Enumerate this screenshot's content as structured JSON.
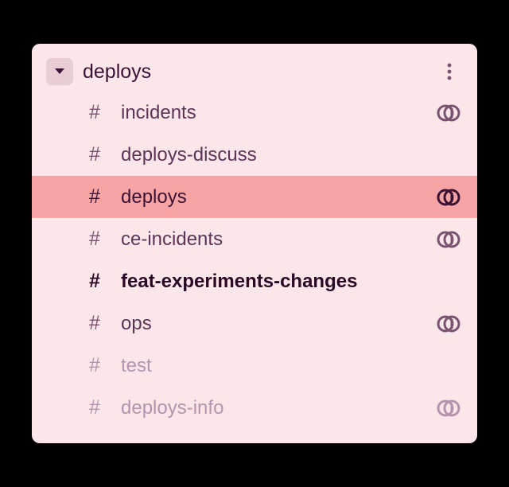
{
  "section": {
    "title": "deploys",
    "expanded": true
  },
  "channels": [
    {
      "name": "incidents",
      "hasThread": true,
      "active": false,
      "unread": false,
      "muted": false
    },
    {
      "name": "deploys-discuss",
      "hasThread": false,
      "active": false,
      "unread": false,
      "muted": false
    },
    {
      "name": "deploys",
      "hasThread": true,
      "active": true,
      "unread": false,
      "muted": false
    },
    {
      "name": "ce-incidents",
      "hasThread": true,
      "active": false,
      "unread": false,
      "muted": false
    },
    {
      "name": "feat-experiments-changes",
      "hasThread": false,
      "active": false,
      "unread": true,
      "muted": false
    },
    {
      "name": "ops",
      "hasThread": true,
      "active": false,
      "unread": false,
      "muted": false
    },
    {
      "name": "test",
      "hasThread": false,
      "active": false,
      "unread": false,
      "muted": true
    },
    {
      "name": "deploys-info",
      "hasThread": true,
      "active": false,
      "unread": false,
      "muted": true
    }
  ],
  "glyphs": {
    "hash": "#"
  }
}
